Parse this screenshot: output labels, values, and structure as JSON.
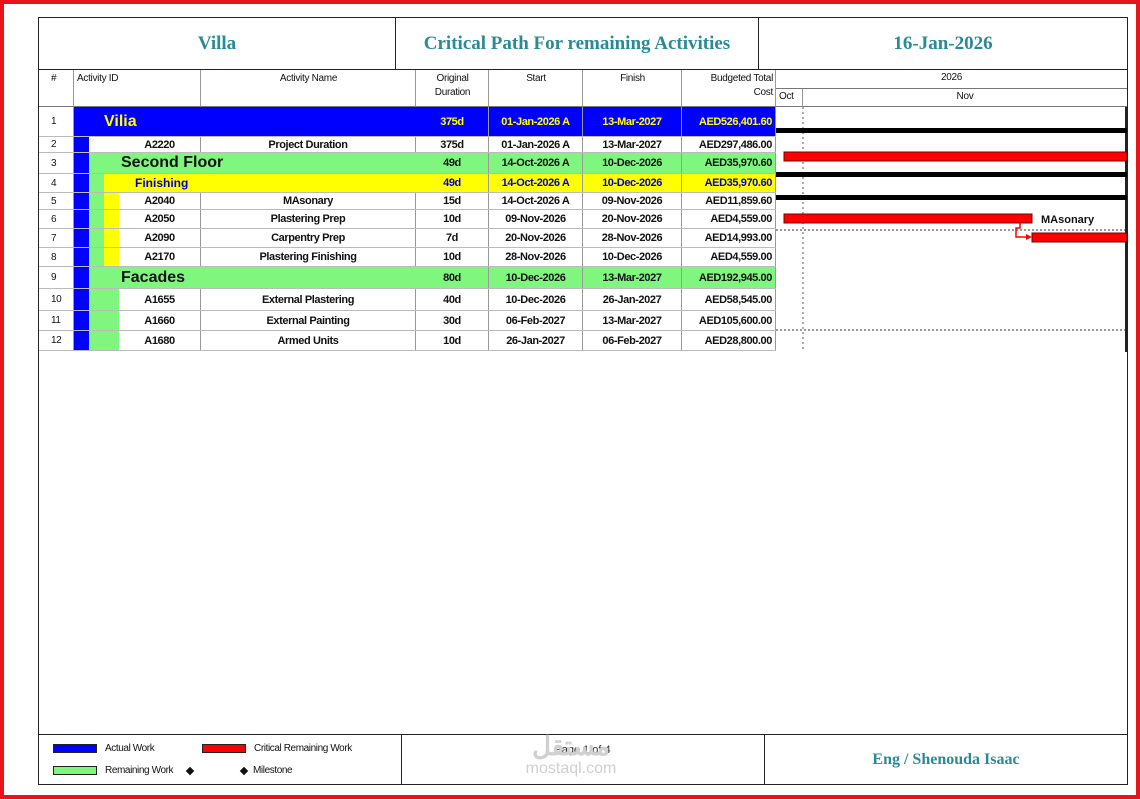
{
  "header": {
    "project": "Villa",
    "title": "Critical Path For remaining Activities",
    "date": "16-Jan-2026"
  },
  "columns": {
    "num": "#",
    "activity_id": "Activity ID",
    "activity_name": "Activity Name",
    "duration_l1": "Original",
    "duration_l2": "Duration",
    "start": "Start",
    "finish": "Finish",
    "cost_l1": "Budgeted Total",
    "cost_l2": "Cost",
    "gantt_year": "2026",
    "gantt_month_1": "Oct",
    "gantt_month_2": "Nov"
  },
  "rows": [
    {
      "n": "1",
      "id": "",
      "name": "Vilia",
      "dur": "375d",
      "start": "01-Jan-2026 A",
      "finish": "13-Mar-2027",
      "cost": "AED526,401.60"
    },
    {
      "n": "2",
      "id": "A2220",
      "name": "Project Duration",
      "dur": "375d",
      "start": "01-Jan-2026 A",
      "finish": "13-Mar-2027",
      "cost": "AED297,486.00"
    },
    {
      "n": "3",
      "id": "",
      "name": "Second Floor",
      "dur": "49d",
      "start": "14-Oct-2026 A",
      "finish": "10-Dec-2026",
      "cost": "AED35,970.60"
    },
    {
      "n": "4",
      "id": "",
      "name": "Finishing",
      "dur": "49d",
      "start": "14-Oct-2026 A",
      "finish": "10-Dec-2026",
      "cost": "AED35,970.60"
    },
    {
      "n": "5",
      "id": "A2040",
      "name": "MAsonary",
      "dur": "15d",
      "start": "14-Oct-2026 A",
      "finish": "09-Nov-2026",
      "cost": "AED11,859.60"
    },
    {
      "n": "6",
      "id": "A2050",
      "name": "Plastering Prep",
      "dur": "10d",
      "start": "09-Nov-2026",
      "finish": "20-Nov-2026",
      "cost": "AED4,559.00"
    },
    {
      "n": "7",
      "id": "A2090",
      "name": "Carpentry Prep",
      "dur": "7d",
      "start": "20-Nov-2026",
      "finish": "28-Nov-2026",
      "cost": "AED14,993.00"
    },
    {
      "n": "8",
      "id": "A2170",
      "name": "Plastering Finishing",
      "dur": "10d",
      "start": "28-Nov-2026",
      "finish": "10-Dec-2026",
      "cost": "AED4,559.00"
    },
    {
      "n": "9",
      "id": "",
      "name": "Facades",
      "dur": "80d",
      "start": "10-Dec-2026",
      "finish": "13-Mar-2027",
      "cost": "AED192,945.00"
    },
    {
      "n": "10",
      "id": "A1655",
      "name": "External Plastering",
      "dur": "40d",
      "start": "10-Dec-2026",
      "finish": "26-Jan-2027",
      "cost": "AED58,545.00"
    },
    {
      "n": "11",
      "id": "A1660",
      "name": "External Painting",
      "dur": "30d",
      "start": "06-Feb-2027",
      "finish": "13-Mar-2027",
      "cost": "AED105,600.00"
    },
    {
      "n": "12",
      "id": "A1680",
      "name": "Armed Units",
      "dur": "10d",
      "start": "26-Jan-2027",
      "finish": "06-Feb-2027",
      "cost": "AED28,800.00"
    }
  ],
  "gantt": {
    "bar_label": "MAsonary"
  },
  "legend": {
    "actual": "Actual Work",
    "critical": "Critical Remaining Work",
    "remaining": "Remaining Work",
    "milestone": "Milestone"
  },
  "footer": {
    "page": "Page 1 of 4",
    "author": "Eng / Shenouda Isaac",
    "watermark_ar": "مستقل",
    "watermark_en": "mostaql.com"
  },
  "colors": {
    "actual": "#0000ff",
    "remaining": "#7ff77f",
    "critical": "#ff0000",
    "wbs_l3": "#ffff00",
    "title": "#2a8a96"
  }
}
